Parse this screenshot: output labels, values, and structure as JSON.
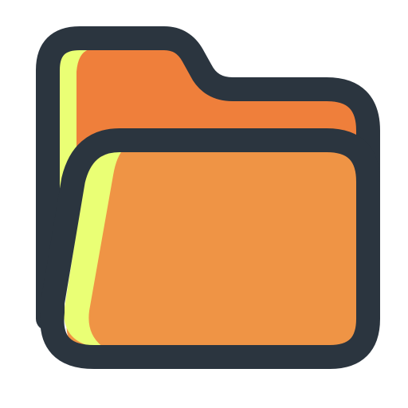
{
  "icon": {
    "name": "folder-open-icon",
    "colors": {
      "outline": "#2B353F",
      "back_fill": "#EF7F3B",
      "front_fill": "#EF9445",
      "highlight": "#EAFF75",
      "background": "#FFFFFF"
    }
  }
}
